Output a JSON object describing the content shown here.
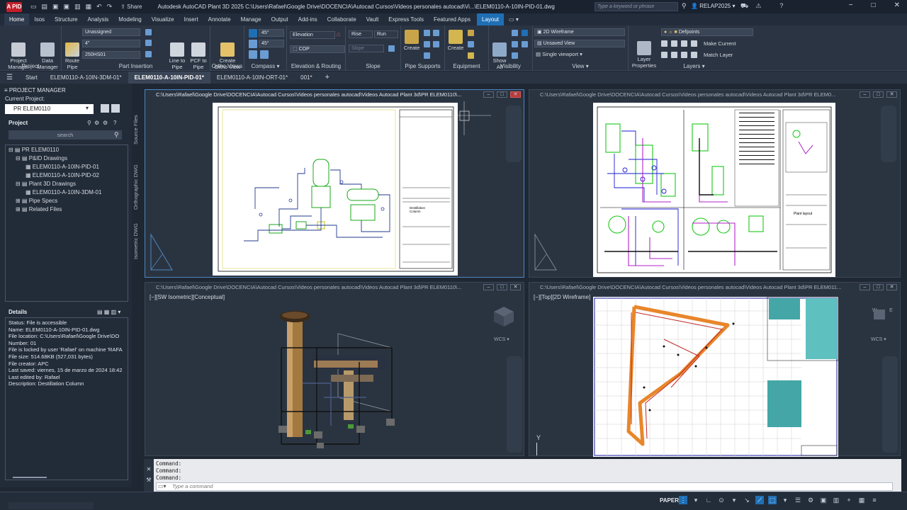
{
  "window": {
    "app_badge": "A PID",
    "share_label": "Share",
    "title": "Autodesk AutoCAD Plant 3D 2025   C:\\Users\\Rafael\\Google Drive\\DOCENCIA\\Autocad Cursos\\Videos personales autocad\\Vi...\\ELEM0110-A-10IN-PID-01.dwg",
    "search_placeholder": "Type a keyword or phrase",
    "user": "RELAP2025"
  },
  "menu": [
    "Home",
    "Isos",
    "Structure",
    "Analysis",
    "Modeling",
    "Visualize",
    "Insert",
    "Annotate",
    "Manage",
    "Output",
    "Add-ins",
    "Collaborate",
    "Vault",
    "Express Tools",
    "Featured Apps",
    "Layout"
  ],
  "ribbon": {
    "project_manager": "Project\nManager",
    "data_manager": "Data\nManager",
    "route_pipe": "Route\nPipe",
    "line_to_pipe": "Line to\nPipe",
    "pcf_to_pipe": "PCF to\nPipe",
    "unassigned": "Unassigned",
    "size": "4\"",
    "spec": "250HS01",
    "panel_project": "Project",
    "panel_part_insertion": "Part Insertion",
    "create_ortho_view": "Create\nOrtho View",
    "panel_ortho_views": "Ortho Views",
    "angle1": "45°",
    "angle2": "45°",
    "panel_compass": "Compass",
    "elevation": "Elevation",
    "cop": "COP",
    "panel_elev_routing": "Elevation & Routing",
    "rise": "Rise",
    "run": "Run",
    "slope": "Slope",
    "panel_slope": "Slope",
    "create1": "Create",
    "panel_pipe_supports": "Pipe Supports",
    "create2": "Create",
    "panel_equipment": "Equipment",
    "show_all": "Show\nAll",
    "panel_visibility": "Visibility",
    "visual_style": "2D Wireframe",
    "saved_view": "Unsaved View",
    "viewport": "Single viewport",
    "panel_view": "View",
    "layer_properties": "Layer\nProperties",
    "layer_name": "Defpoints",
    "make_current": "Make Current",
    "match_layer": "Match Layer",
    "panel_layers": "Layers"
  },
  "tabs": [
    "Start",
    "ELEM0110-A-10IN-3DM-01*",
    "ELEM0110-A-10IN-PID-01*",
    "ELEM0110-A-10IN-ORT-01*",
    "001*"
  ],
  "project_manager": {
    "title": "PROJECT MANAGER",
    "current_project_label": "Current Project:",
    "current_project": "PR ELEM0110",
    "project_heading": "Project",
    "search": "search",
    "tree": {
      "root": "PR ELEM0110",
      "pid": "P&ID Drawings",
      "pid1": "ELEM0110-A-10IN-PID-01",
      "pid2": "ELEM0110-A-10IN-PID-02",
      "p3d": "Plant 3D Drawings",
      "dm1": "ELEM0110-A-10IN-3DM-01",
      "specs": "Pipe Specs",
      "related": "Related Files"
    },
    "details_heading": "Details",
    "details": [
      "Status: File is accessible",
      "Name: ELEM0110-A-10IN-PID-01.dwg",
      "File location: C:\\Users\\Rafael\\Google Drive\\DO",
      "Number: 01",
      "File is locked by user 'Rafael' on machine 'RAFA",
      "File size: 514.68KB (527,031 bytes)",
      "File creator: APC",
      "Last saved: viernes, 15 de marzo de 2024 18:42",
      "Last edited by: Rafael",
      "Description: Destillation Column"
    ],
    "side_tabs": [
      "Source Files",
      "Orthographic DWG",
      "Isometric DWG"
    ]
  },
  "viewports": {
    "v1_title": "C:\\Users\\Rafael\\Google Drive\\DOCENCIA\\Autocad Cursos\\Videos personales autocad\\Videos Autocad Plant 3d\\PR ELEM0110\\...",
    "v2_title": "C:\\Users\\Rafael\\Google Drive\\DOCENCIA\\Autocad Cursos\\Videos personales autocad\\Videos Autocad Plant 3d\\PR ELEM0...",
    "v3_title": "C:\\Users\\Rafael\\Google Drive\\DOCENCIA\\Autocad Cursos\\Videos personales autocad\\Videos Autocad Plant 3d\\PR ELEM0110\\...",
    "v4_title": "C:\\Users\\Rafael\\Google Drive\\DOCENCIA\\Autocad Cursos\\Videos personales autocad\\Videos Autocad Plant 3d\\PR ELEM011...",
    "v3_label": "[−][SW Isometric][Conceptual]",
    "v4_label": "[−][Top][2D Wireframe]",
    "wcs": "WCS",
    "v1_sheet_title": "Destillation\nColumn",
    "v2_sheet_title": "Plant layout"
  },
  "command": {
    "history": [
      "Command:",
      "Command:",
      "Command:"
    ],
    "placeholder": "Type a command"
  },
  "status": {
    "space": "PAPER"
  },
  "colors": {
    "accent": "#1f6fb5",
    "background": "#1f2733"
  }
}
